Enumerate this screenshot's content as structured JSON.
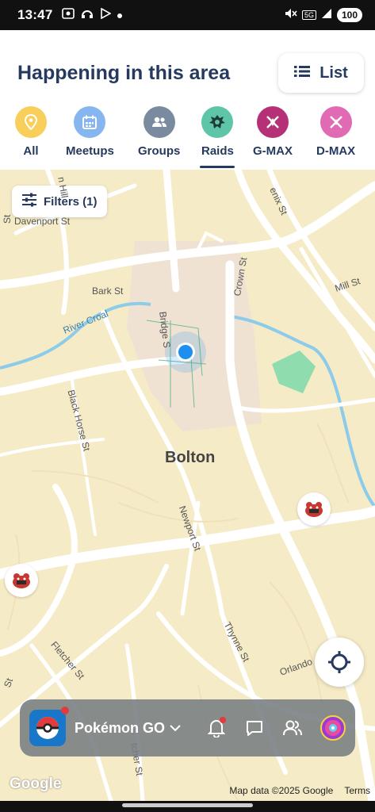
{
  "status": {
    "time": "13:47",
    "network": "5G",
    "battery": "100"
  },
  "header": {
    "title": "Happening in this area",
    "list_label": "List"
  },
  "categories": [
    {
      "label": "All",
      "color": "#f7cf5a",
      "icon": "pin-icon"
    },
    {
      "label": "Meetups",
      "color": "#86b6ef",
      "icon": "calendar-icon"
    },
    {
      "label": "Groups",
      "color": "#7a8ba0",
      "icon": "people-icon"
    },
    {
      "label": "Raids",
      "color": "#5fc5a9",
      "icon": "raid-icon",
      "selected": true
    },
    {
      "label": "G-MAX",
      "color": "#b63077",
      "icon": "gmax-icon"
    },
    {
      "label": "D-MAX",
      "color": "#e06ab4",
      "icon": "dmax-icon"
    }
  ],
  "map": {
    "filters_label": "Filters (1)",
    "town": "Bolton",
    "streets": {
      "davenport": "Davenport St",
      "bark": "Bark St",
      "river": "River Croal",
      "bridge": "Bridge S",
      "crown": "Crown St",
      "mill": "Mill St",
      "black_horse": "Black Horse St",
      "newport": "Newport St",
      "thynne": "Thynne St",
      "orlando": "Orlando",
      "fletcher1": "Fletcher St",
      "fletcher2": "tcher St",
      "ashburner": "enix St",
      "nhill": "n Hill",
      "st_left": "St",
      "st_left2": "St"
    },
    "google_logo": "Google",
    "map_data": "Map data ©2025 Google",
    "terms": "Terms"
  },
  "appbar": {
    "app_name": "Pokémon GO"
  },
  "colors": {
    "map_bg": "#f6ebc7",
    "road": "#ffffff",
    "water": "#8ccbea",
    "park": "#8fdcae",
    "user_dot": "#1f8ef1",
    "header_text": "#253a5e"
  }
}
